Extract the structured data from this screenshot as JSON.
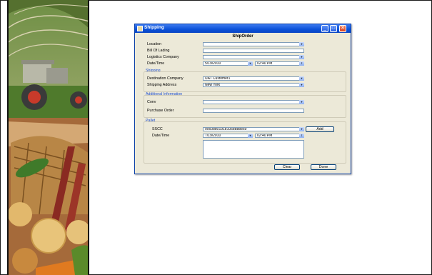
{
  "window": {
    "title": "Shipping",
    "heading": "ShipOrder"
  },
  "fields": {
    "location": {
      "label": "Location",
      "value": ""
    },
    "bill_of_lading": {
      "label": "Bill Of Lading",
      "value": ""
    },
    "logistics_company": {
      "label": "Logistics Company",
      "value": ""
    },
    "date_time": {
      "label": "Date/Time",
      "date": "5/19/2010",
      "time": "02:40  PM"
    }
  },
  "shipping": {
    "section": "Shipping",
    "destination_company": {
      "label": "Destination Company",
      "value": "UAT Customer1"
    },
    "shipping_address": {
      "label": "Shipping Address",
      "value": "New York"
    }
  },
  "additional": {
    "section": "Additional Information",
    "conv": {
      "label": "Conv",
      "value": ""
    },
    "purchase_order": {
      "label": "Purchase Order",
      "value": ""
    }
  },
  "pallet": {
    "section": "Pallet",
    "sscc": {
      "label": "SSCC",
      "value": "006088019181058888869"
    },
    "add_button": "Add",
    "date_time": {
      "label": "Date/Time",
      "date": "7/19/2010",
      "time": "02:40  PM"
    }
  },
  "buttons": {
    "clear": "Clear",
    "done": "Done"
  },
  "colors": {
    "titlebar": "#0a50d8",
    "dialog_bg": "#ece9d8",
    "section_text": "#1f4fcf"
  },
  "icons": {
    "dropdown": "▼",
    "spinner": "⇕",
    "minimize": "_",
    "maximize": "□",
    "close": "✕"
  }
}
